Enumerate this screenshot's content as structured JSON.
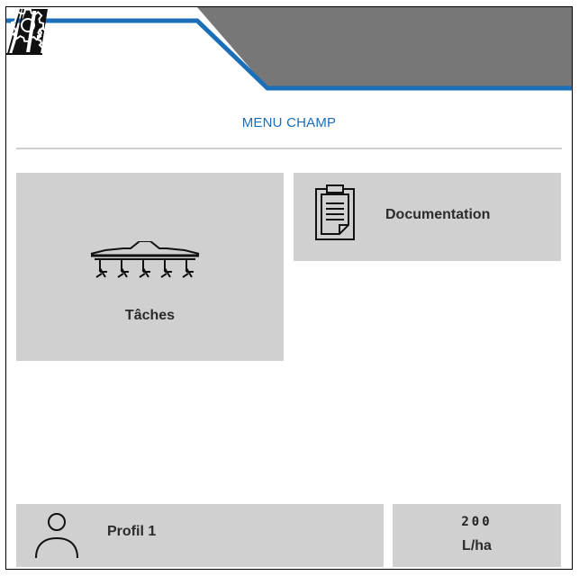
{
  "header": {
    "tabs": [
      {
        "id": "field",
        "icon": "field-icon",
        "active": true
      },
      {
        "id": "settings",
        "icon": "gears-icon",
        "active": false
      }
    ],
    "accent_color": "#1a6fb8",
    "inactive_tab_color": "#777777"
  },
  "page": {
    "title": "MENU CHAMP"
  },
  "tiles": {
    "taches": {
      "label": "Tâches",
      "icon": "seeder-icon"
    },
    "documentation": {
      "label": "Documentation",
      "icon": "clipboard-icon"
    }
  },
  "footer": {
    "profile": {
      "label": "Profil 1",
      "icon": "person-icon"
    },
    "rate": {
      "value": "200",
      "unit": "L/ha"
    }
  },
  "colors": {
    "tile_background": "#d0d0d0",
    "title_color": "#1a6fb8"
  }
}
